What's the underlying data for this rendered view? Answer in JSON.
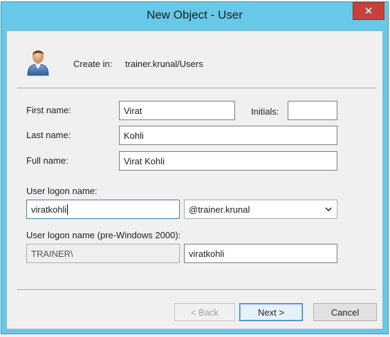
{
  "window": {
    "title": "New Object - User",
    "close_glyph": "✕"
  },
  "header": {
    "icon": "user-icon",
    "create_in_label": "Create in:",
    "create_in_value": "trainer.krunal/Users"
  },
  "form": {
    "first_name": {
      "label": "First name:",
      "value": "Virat"
    },
    "initials": {
      "label": "Initials:",
      "value": ""
    },
    "last_name": {
      "label": "Last name:",
      "value": "Kohli"
    },
    "full_name": {
      "label": "Full name:",
      "value": "Virat Kohli"
    },
    "logon_name": {
      "label": "User logon name:",
      "value": "viratkohli",
      "domain": "@trainer.krunal"
    },
    "pre2000": {
      "label": "User logon name (pre-Windows 2000):",
      "domain": "TRAINER\\",
      "value": "viratkohli"
    }
  },
  "buttons": {
    "back": "< Back",
    "next": "Next >",
    "cancel": "Cancel"
  },
  "colors": {
    "titlebar": "#68c8e8",
    "close": "#c7413c",
    "dialog_bg": "#f0f0f0"
  }
}
